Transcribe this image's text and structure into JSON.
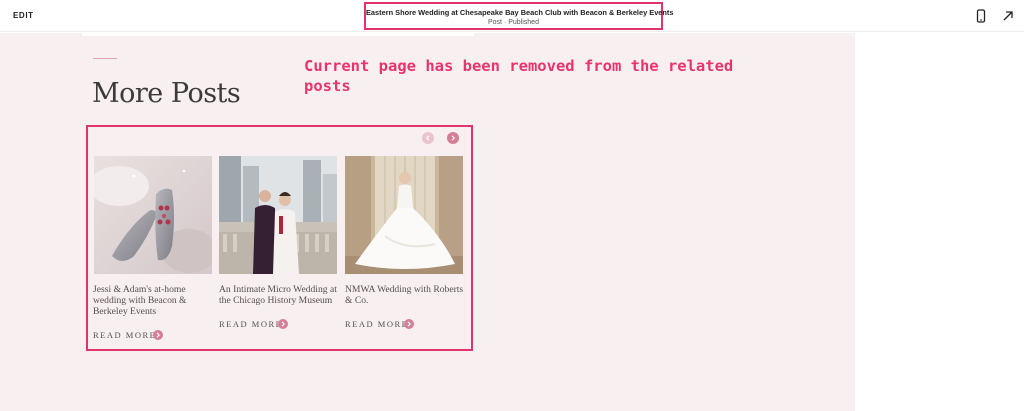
{
  "toolbar": {
    "edit_label": "EDIT",
    "page_title": "Eastern Shore Wedding at Chesapeake Bay Beach Club with Beacon & Berkeley Events",
    "page_status": "Post · Published",
    "icons": [
      "mobile-preview-icon",
      "open-external-icon"
    ]
  },
  "section": {
    "title": "More Posts"
  },
  "annotation": "Current page has been removed from the related posts",
  "carousel": {
    "prev_icon": "chevron-left-icon",
    "next_icon": "chevron-right-icon",
    "posts": [
      {
        "title": "Jessi & Adam's at-home wedding with Beacon & Berkeley Events",
        "read_more": "READ MORE",
        "image": "sparkly-shoes-photo"
      },
      {
        "title": "An Intimate Micro Wedding at the Chicago History Museum",
        "read_more": "READ MORE",
        "image": "couple-city-photo"
      },
      {
        "title": "NMWA Wedding with Roberts & Co.",
        "read_more": "READ MORE",
        "image": "bride-gown-photo"
      }
    ]
  },
  "colors": {
    "accent": "#e0336f",
    "page_bg": "#f7eff0",
    "arrow": "#d57e95"
  }
}
